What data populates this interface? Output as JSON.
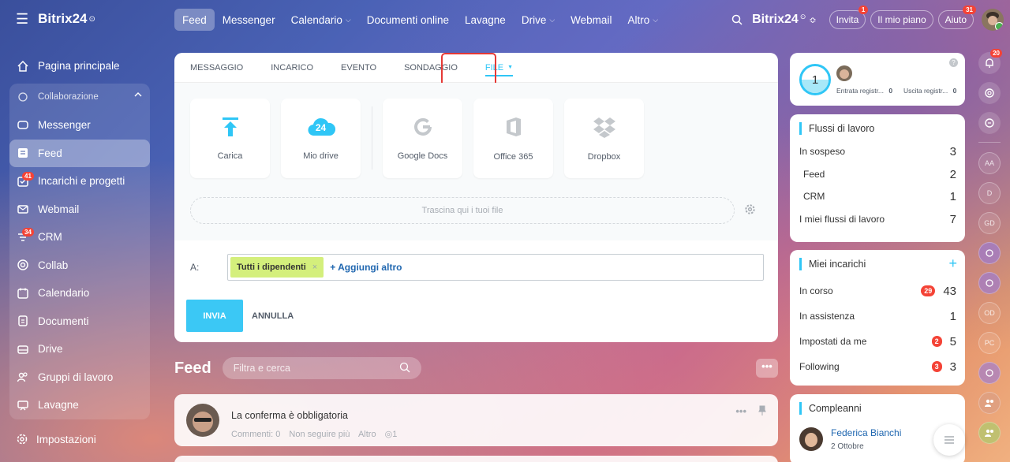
{
  "app": {
    "name": "Bitrix24",
    "sup": "⊙"
  },
  "sidebar": {
    "items": [
      {
        "label": "Pagina principale"
      },
      {
        "label": "Collaborazione"
      },
      {
        "label": "Messenger"
      },
      {
        "label": "Feed"
      },
      {
        "label": "Incarichi e progetti",
        "badge": "41"
      },
      {
        "label": "Webmail"
      },
      {
        "label": "CRM",
        "badge": "34"
      },
      {
        "label": "Collab"
      },
      {
        "label": "Calendario"
      },
      {
        "label": "Documenti"
      },
      {
        "label": "Drive"
      },
      {
        "label": "Gruppi di lavoro"
      },
      {
        "label": "Lavagne"
      }
    ],
    "settings": "Impostazioni"
  },
  "topnav": {
    "items": [
      "Feed",
      "Messenger",
      "Calendario",
      "Documenti online",
      "Lavagne",
      "Drive",
      "Webmail",
      "Altro"
    ],
    "brand": "Bitrix24",
    "invite": "Invita",
    "invite_badge": "1",
    "plan": "Il mio piano",
    "help": "Aiuto",
    "help_badge": "31"
  },
  "strip": {
    "notif_badge": "20",
    "avatars": [
      "AA",
      "D",
      "GD",
      "",
      "",
      "OD",
      "PC",
      "",
      "",
      ""
    ]
  },
  "composer": {
    "tabs": [
      "MESSAGGIO",
      "INCARICO",
      "EVENTO",
      "SONDAGGIO",
      "FILE"
    ],
    "tiles": [
      "Carica",
      "Mio drive",
      "Google Docs",
      "Office 365",
      "Dropbox"
    ],
    "drive_badge": "24",
    "drop": "Trascina qui i tuoi file",
    "to_label": "A:",
    "recipient": "Tutti i dipendenti",
    "add_more": "+ Aggiungi altro",
    "send": "INVIA",
    "cancel": "ANNULLA"
  },
  "feed": {
    "title": "Feed",
    "search_placeholder": "Filtra e cerca",
    "more": "•••",
    "post": {
      "title": "La conferma è obbligatoria",
      "comments": "Commenti: 0",
      "unfollow": "Non seguire più",
      "other": "Altro",
      "views": "1",
      "dots": "•••"
    }
  },
  "timeman": {
    "count": "1",
    "in_label": "Entrata registr...",
    "in_val": "0",
    "out_label": "Uscita registr...",
    "out_val": "0",
    "help": "?"
  },
  "workflows": {
    "title": "Flussi di lavoro",
    "rows": [
      {
        "label": "In sospeso",
        "value": "3"
      },
      {
        "label": "Feed",
        "value": "2"
      },
      {
        "label": "CRM",
        "value": "1"
      },
      {
        "label": "I miei flussi di lavoro",
        "value": "7"
      }
    ]
  },
  "tasks": {
    "title": "Miei incarichi",
    "plus": "+",
    "rows": [
      {
        "label": "In corso",
        "badge": "29",
        "value": "43"
      },
      {
        "label": "In assistenza",
        "value": "1"
      },
      {
        "label": "Impostati da me",
        "badge": "2",
        "value": "5"
      },
      {
        "label": "Following",
        "badge": "3",
        "value": "3"
      }
    ]
  },
  "birthdays": {
    "title": "Compleanni",
    "name": "Federica Bianchi",
    "date": "2 Ottobre"
  },
  "colors": {
    "accent": "#2fc6f6",
    "badge": "#f44336",
    "chip": "#d4ef7c",
    "highlight": "#e53935"
  }
}
